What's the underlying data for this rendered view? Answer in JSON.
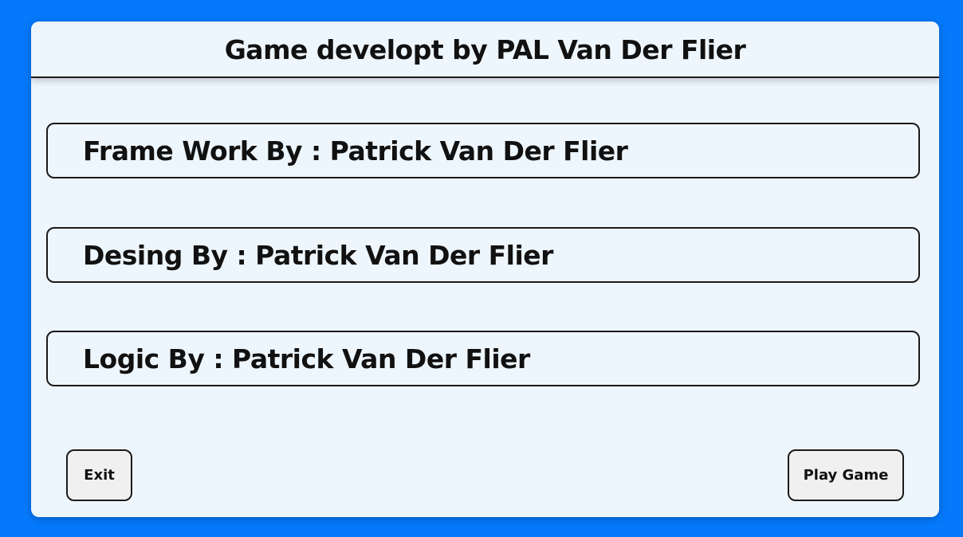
{
  "header": {
    "title": "Game developt by PAL Van Der Flier"
  },
  "credits": [
    {
      "text": "Frame Work By : Patrick Van Der Flier"
    },
    {
      "text": "Desing By : Patrick Van Der Flier"
    },
    {
      "text": "Logic By : Patrick Van Der Flier"
    }
  ],
  "buttons": {
    "exit_label": "Exit",
    "play_label": "Play Game"
  },
  "colors": {
    "background": "#0579fb",
    "panel": "#eef6fd",
    "button": "#f0f0f0",
    "border": "#1a1a1a"
  }
}
